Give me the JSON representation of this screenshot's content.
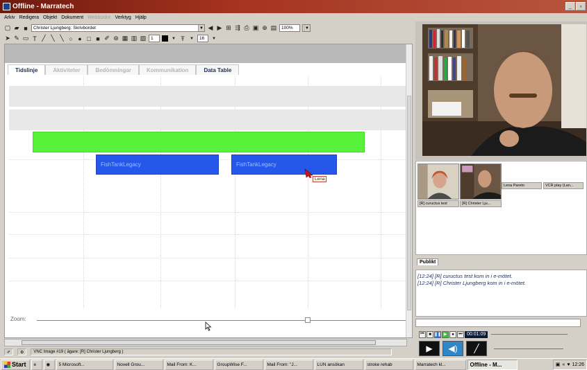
{
  "window": {
    "title": "Offline - Marratech"
  },
  "menu": [
    "Arkiv",
    "Redigera",
    "Objekt",
    "Dokument",
    "Webbsidor",
    "Verktyg",
    "Hjälp"
  ],
  "menu_disabled_index": 4,
  "toolbar": {
    "doc_combo": "Christer Ljungberg: Skrivbordet",
    "zoom_combo": "100%",
    "line_combo": "1",
    "font_size_combo": "16"
  },
  "tabs": [
    "Tidslinje",
    "Aktiviteter",
    "Bedömningar",
    "Kommunikation",
    "Data Table"
  ],
  "timeline": {
    "bars": [
      {
        "label": "FishTankLegacy"
      },
      {
        "label": "FishTankLegacy"
      }
    ],
    "cursor_tooltip": "Lena",
    "zoom_label": "Zoom:"
  },
  "status": {
    "text": "VNC Image #19 ( ägare: [R] Christer Ljungberg )"
  },
  "participants": [
    {
      "name": "[R] cuructus test"
    },
    {
      "name": "[R] Christer Lju..."
    },
    {
      "name": "Lena Pareto"
    },
    {
      "name": "VCR play (Lan..."
    }
  ],
  "chat": {
    "tab": "Publikt",
    "messages": [
      "[12:24] [R] cuructus test kom in i e-mötet.",
      "[12:24] [R] Christer Ljungberg kom in i e-mötet."
    ]
  },
  "media": {
    "time": "00:01:09"
  },
  "taskbar": {
    "start": "Start",
    "tasks": [
      "5 Microsoft...",
      "Novell Grou...",
      "Mail From: K...",
      "GroupWise F...",
      "Mail From: \"J...",
      "LUN ansökan",
      "stroke rehab",
      "Marratech kl...",
      "Offline - M..."
    ],
    "clock": "12:26"
  },
  "colors": {
    "green_bar": "#59f23b",
    "blue_bar": "#2557ea",
    "titlebar": "#a5331f"
  }
}
